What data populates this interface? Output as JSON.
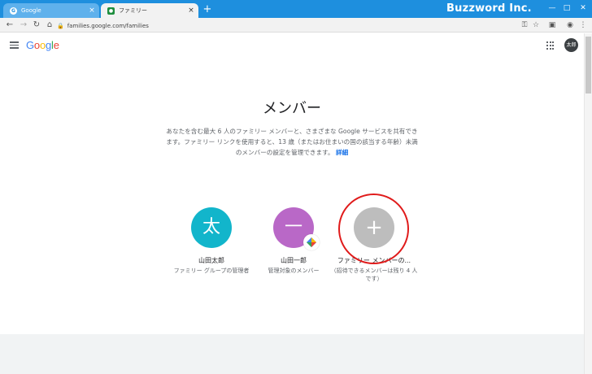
{
  "browser": {
    "tabs": [
      {
        "title": "Google",
        "favicon": "google-g-icon",
        "active": false
      },
      {
        "title": "ファミリー",
        "favicon": "family-icon",
        "active": true
      }
    ],
    "new_tab_label": "+",
    "close_glyph": "×",
    "brand": "Buzzword Inc.",
    "url": "families.google.com/families"
  },
  "appbar": {
    "logo": [
      "G",
      "o",
      "o",
      "g",
      "l",
      "e"
    ],
    "logo_colors": [
      "#4285F4",
      "#EA4335",
      "#FBBC05",
      "#4285F4",
      "#34A853",
      "#EA4335"
    ],
    "avatar_text": "太郎"
  },
  "main": {
    "title": "メンバー",
    "description": "あなたを含む最大 6 人のファミリー メンバーと、さまざまな Google サービスを共有できます。ファミリー リンクを使用すると、13 歳（またはお住まいの国の該当する年齢）未満のメンバーの設定を管理できます。",
    "details_link": "詳細",
    "members": [
      {
        "initial": "太",
        "name": "山田太郎",
        "role": "ファミリー グループの管理者",
        "color": "#12b5cb"
      },
      {
        "initial": "一",
        "name": "山田一郎",
        "role": "管理対象のメンバー",
        "color": "#b968c7",
        "badge": "family-link-icon"
      },
      {
        "initial": "+",
        "name": "ファミリー メンバーの...",
        "role": "（招待できるメンバーは残り 4 人です）",
        "color": "#bdbdbd"
      }
    ],
    "highlight_color": "#e01b1b"
  }
}
